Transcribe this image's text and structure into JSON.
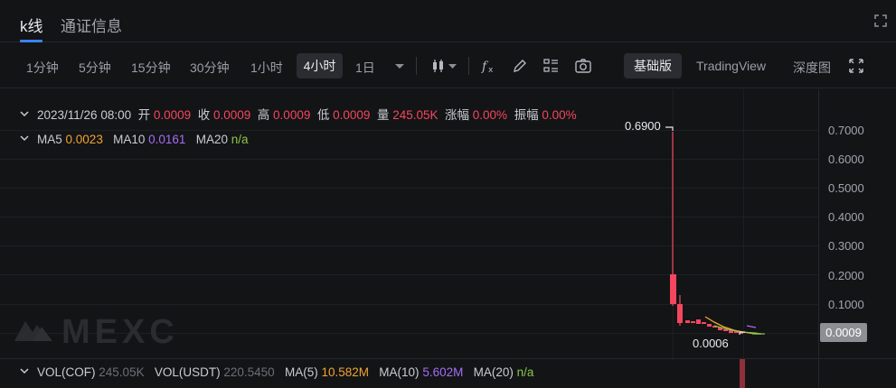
{
  "tabs": [
    {
      "label": "k线",
      "active": true
    },
    {
      "label": "通证信息",
      "active": false
    }
  ],
  "toolbar": {
    "intervals": [
      "1分钟",
      "5分钟",
      "15分钟",
      "30分钟",
      "1小时",
      "4小时",
      "1日"
    ],
    "active_interval": "4小时",
    "modes": [
      "基础版",
      "TradingView",
      "深度图"
    ],
    "active_mode": "基础版"
  },
  "info": {
    "datetime": "2023/11/26 08:00",
    "open_label": "开",
    "open": "0.0009",
    "close_label": "收",
    "close": "0.0009",
    "high_label": "高",
    "high": "0.0009",
    "low_label": "低",
    "low": "0.0009",
    "vol_label": "量",
    "vol": "245.05K",
    "change_label": "涨幅",
    "change": "0.00%",
    "amp_label": "振幅",
    "amp": "0.00%"
  },
  "ma": {
    "ma5_label": "MA5",
    "ma5": "0.0023",
    "ma10_label": "MA10",
    "ma10": "0.0161",
    "ma20_label": "MA20",
    "ma20": "n/a"
  },
  "volume": {
    "vol_cof_label": "VOL(COF)",
    "vol_cof": "245.05K",
    "vol_usdt_label": "VOL(USDT)",
    "vol_usdt": "220.5450",
    "ma5_label": "MA(5)",
    "ma5": "10.582M",
    "ma10_label": "MA(10)",
    "ma10": "5.602M",
    "ma20_label": "MA(20)",
    "ma20": "n/a"
  },
  "yaxis": [
    "0.7000",
    "0.6000",
    "0.5000",
    "0.4000",
    "0.3000",
    "0.2000",
    "0.1000"
  ],
  "last_price": "0.0009",
  "high_marker": "0.6900",
  "low_marker": "0.0006",
  "watermark": "MEXC",
  "colors": {
    "up": "#f6465d",
    "ma5": "#f0a431",
    "ma10": "#a66cf5",
    "ma20": "#8bc34a",
    "accent": "#3b82f6"
  }
}
